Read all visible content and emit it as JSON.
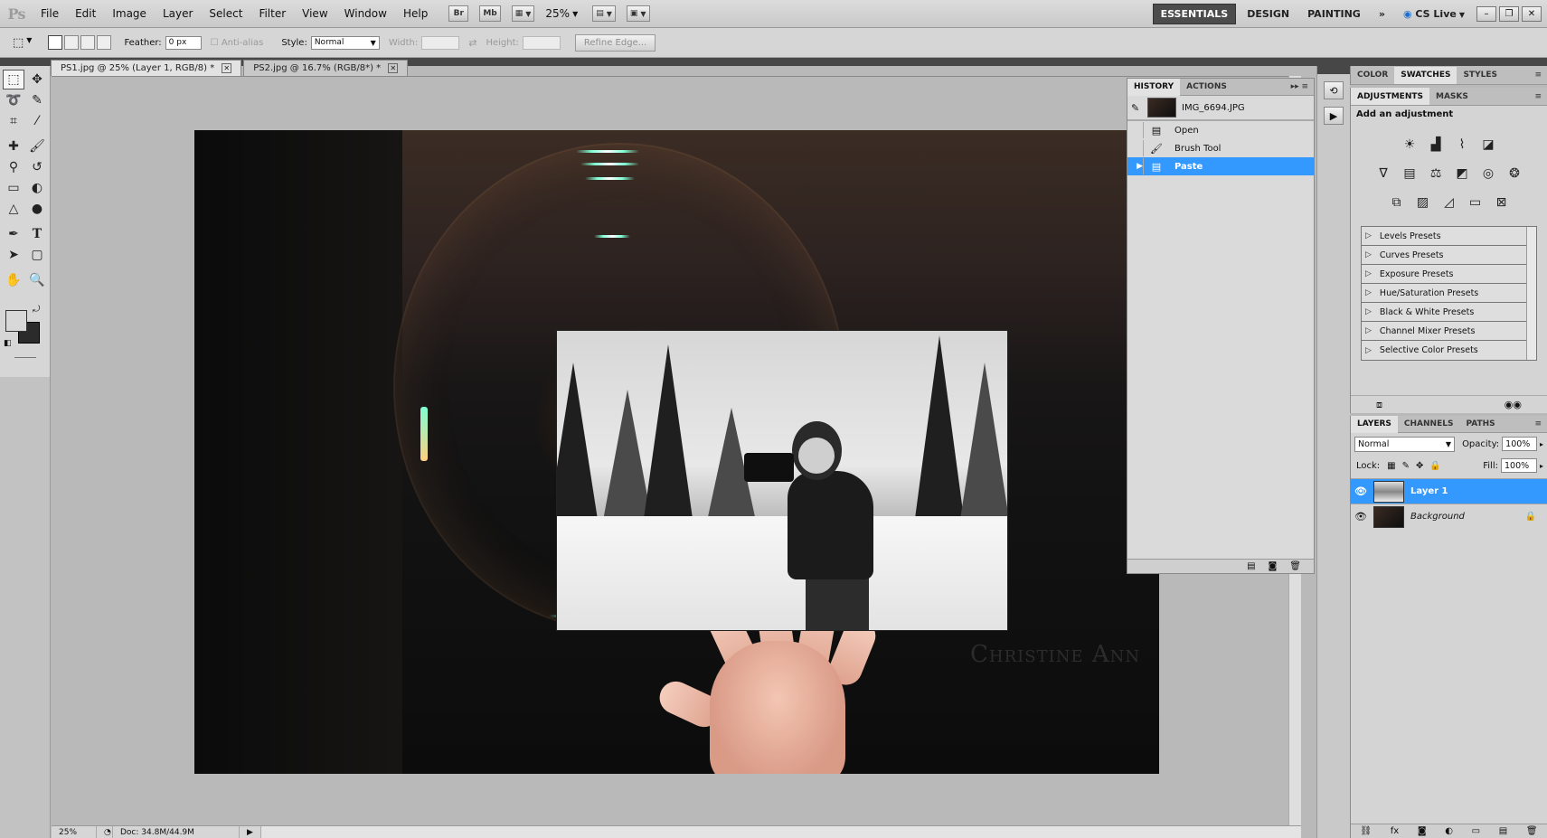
{
  "app": {
    "logo": "Ps",
    "menu": [
      "File",
      "Edit",
      "Image",
      "Layer",
      "Select",
      "Filter",
      "View",
      "Window",
      "Help"
    ],
    "bridge_label": "Br",
    "mini_bridge_label": "Mb",
    "zoom": "25%",
    "workspaces": [
      "ESSENTIALS",
      "DESIGN",
      "PAINTING"
    ],
    "more_workspaces": "»",
    "cs_live": "CS Live"
  },
  "options": {
    "feather_label": "Feather:",
    "feather_value": "0 px",
    "anti_alias_label": "Anti-alias",
    "style_label": "Style:",
    "style_value": "Normal",
    "width_label": "Width:",
    "height_label": "Height:",
    "refine_edge": "Refine Edge..."
  },
  "tabs": [
    {
      "label": "PS1.jpg @ 25% (Layer 1, RGB/8) *",
      "active": true
    },
    {
      "label": "PS2.jpg @ 16.7% (RGB/8*) *",
      "active": false
    }
  ],
  "canvas": {
    "watermark": "Christine Ann"
  },
  "status": {
    "zoom": "25%",
    "doc": "Doc: 34.8M/44.9M"
  },
  "history": {
    "tabs": [
      "HISTORY",
      "ACTIONS"
    ],
    "snapshot": "IMG_6694.JPG",
    "states": [
      {
        "label": "Open",
        "icon": "document-icon"
      },
      {
        "label": "Brush Tool",
        "icon": "brush-icon"
      },
      {
        "label": "Paste",
        "icon": "document-icon",
        "selected": true
      }
    ]
  },
  "color_panel": {
    "tabs": [
      "COLOR",
      "SWATCHES",
      "STYLES"
    ]
  },
  "adjustments": {
    "tabs": [
      "ADJUSTMENTS",
      "MASKS"
    ],
    "title": "Add an adjustment",
    "presets": [
      "Levels Presets",
      "Curves Presets",
      "Exposure Presets",
      "Hue/Saturation Presets",
      "Black & White Presets",
      "Channel Mixer Presets",
      "Selective Color Presets"
    ]
  },
  "layers": {
    "tabs": [
      "LAYERS",
      "CHANNELS",
      "PATHS"
    ],
    "blend_mode": "Normal",
    "opacity_label": "Opacity:",
    "opacity_value": "100%",
    "lock_label": "Lock:",
    "fill_label": "Fill:",
    "fill_value": "100%",
    "items": [
      {
        "name": "Layer 1",
        "selected": true
      },
      {
        "name": "Background",
        "selected": false,
        "locked": true
      }
    ]
  },
  "colors": {
    "selection_blue": "#3399ff",
    "panel_gray": "#d4d4d4",
    "dark_workspace": "#474747"
  }
}
